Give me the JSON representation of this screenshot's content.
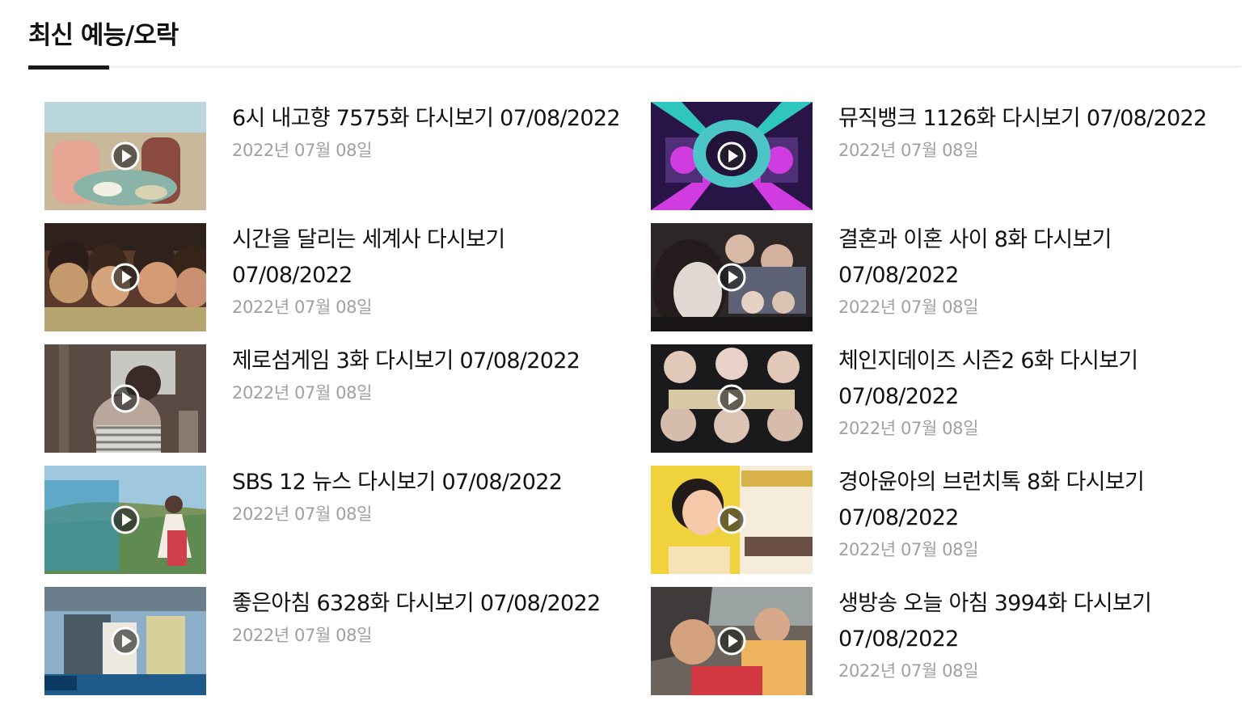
{
  "section": {
    "title": "최신 예능/오락"
  },
  "videos": [
    {
      "title": "6시 내고향 7575화 다시보기 07/08/2022",
      "date": "2022년 07월 08일",
      "thumbnail_colors": [
        "#c9b89a",
        "#8bb4a8"
      ]
    },
    {
      "title": "시간을 달리는 세계사 다시보기 07/08/2022",
      "date": "2022년 07월 08일",
      "thumbnail_colors": [
        "#5a3a2a",
        "#c49a6c"
      ]
    },
    {
      "title": "제로섬게임 3화 다시보기 07/08/2022",
      "date": "2022년 07월 08일",
      "thumbnail_colors": [
        "#5b4a44",
        "#b9a79b"
      ]
    },
    {
      "title": "SBS 12 뉴스 다시보기 07/08/2022",
      "date": "2022년 07월 08일",
      "thumbnail_colors": [
        "#9fc7de",
        "#5f8a52"
      ]
    },
    {
      "title": "좋은아침 6328화 다시보기 07/08/2022",
      "date": "2022년 07월 08일",
      "thumbnail_colors": [
        "#8caec9",
        "#d7d09a"
      ]
    },
    {
      "title": "뮤직뱅크 1126화 다시보기 07/08/2022",
      "date": "2022년 07월 08일",
      "thumbnail_colors": [
        "#281446",
        "#d13ce0"
      ]
    },
    {
      "title": "결혼과 이혼 사이 8화 다시보기 07/08/2022",
      "date": "2022년 07월 08일",
      "thumbnail_colors": [
        "#2d2627",
        "#e1d8d3"
      ]
    },
    {
      "title": "체인지데이즈 시즌2 6화 다시보기 07/08/2022",
      "date": "2022년 07월 08일",
      "thumbnail_colors": [
        "#1a1a1c",
        "#d8c8a4"
      ]
    },
    {
      "title": "경아윤아의 브런치톡 8화 다시보기 07/08/2022",
      "date": "2022년 07월 08일",
      "thumbnail_colors": [
        "#f0d33c",
        "#f6ecdc"
      ]
    },
    {
      "title": "생방송 오늘 아침 3994화 다시보기 07/08/2022",
      "date": "2022년 07월 08일",
      "thumbnail_colors": [
        "#6c645c",
        "#d33842"
      ]
    }
  ],
  "icons": {
    "play": "play-icon"
  }
}
